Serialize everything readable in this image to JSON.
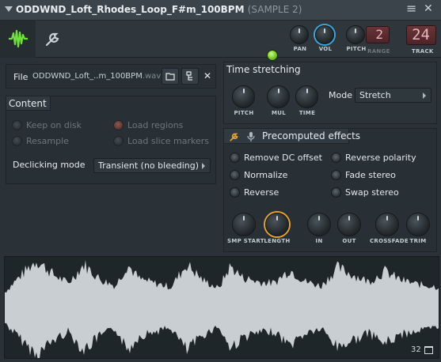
{
  "window": {
    "title": "ODDWND_Loft_Rhodes_Loop_F#m_100BPM",
    "subtitle": "(SAMPLE 2)"
  },
  "toolbar": {
    "tabs": [
      {
        "icon": "waveform-icon",
        "active": true
      },
      {
        "icon": "wrench-icon",
        "active": false
      }
    ],
    "on_label": "ON",
    "pan_label": "PAN",
    "vol_label": "VOL",
    "pitch_label": "PITCH",
    "range_label": "RANGE",
    "range_value": "2",
    "track_label": "TRACK",
    "track_value": "24"
  },
  "file": {
    "label": "File",
    "name": "ODDWND_Loft_..m_100BPM",
    "ext": ".wav"
  },
  "content": {
    "title": "Content",
    "keep_on_disk": "Keep on disk",
    "resample": "Resample",
    "load_regions": "Load regions",
    "load_slice_markers": "Load slice markers",
    "declicking_label": "Declicking mode",
    "declicking_value": "Transient (no bleeding)"
  },
  "time_stretching": {
    "title": "Time stretching",
    "pitch_label": "PITCH",
    "mul_label": "MUL",
    "time_label": "TIME",
    "mode_label": "Mode",
    "mode_value": "Stretch"
  },
  "precomputed": {
    "title": "Precomputed effects",
    "remove_dc": "Remove DC offset",
    "normalize": "Normalize",
    "reverse": "Reverse",
    "reverse_polarity": "Reverse polarity",
    "fade_stereo": "Fade stereo",
    "swap_stereo": "Swap stereo",
    "smp_start": "SMP START",
    "length": "LENGTH",
    "in": "IN",
    "out": "OUT",
    "crossfade": "CROSSFADE",
    "trim": "TRIM"
  },
  "waveform": {
    "count": "32",
    "waveform_color": "#c8ced2"
  },
  "colors": {
    "accent_orange": "#e8a22b",
    "accent_blue": "#3aa7dd",
    "led_green": "#7fd72a",
    "counter_red": "#5d2c30"
  }
}
